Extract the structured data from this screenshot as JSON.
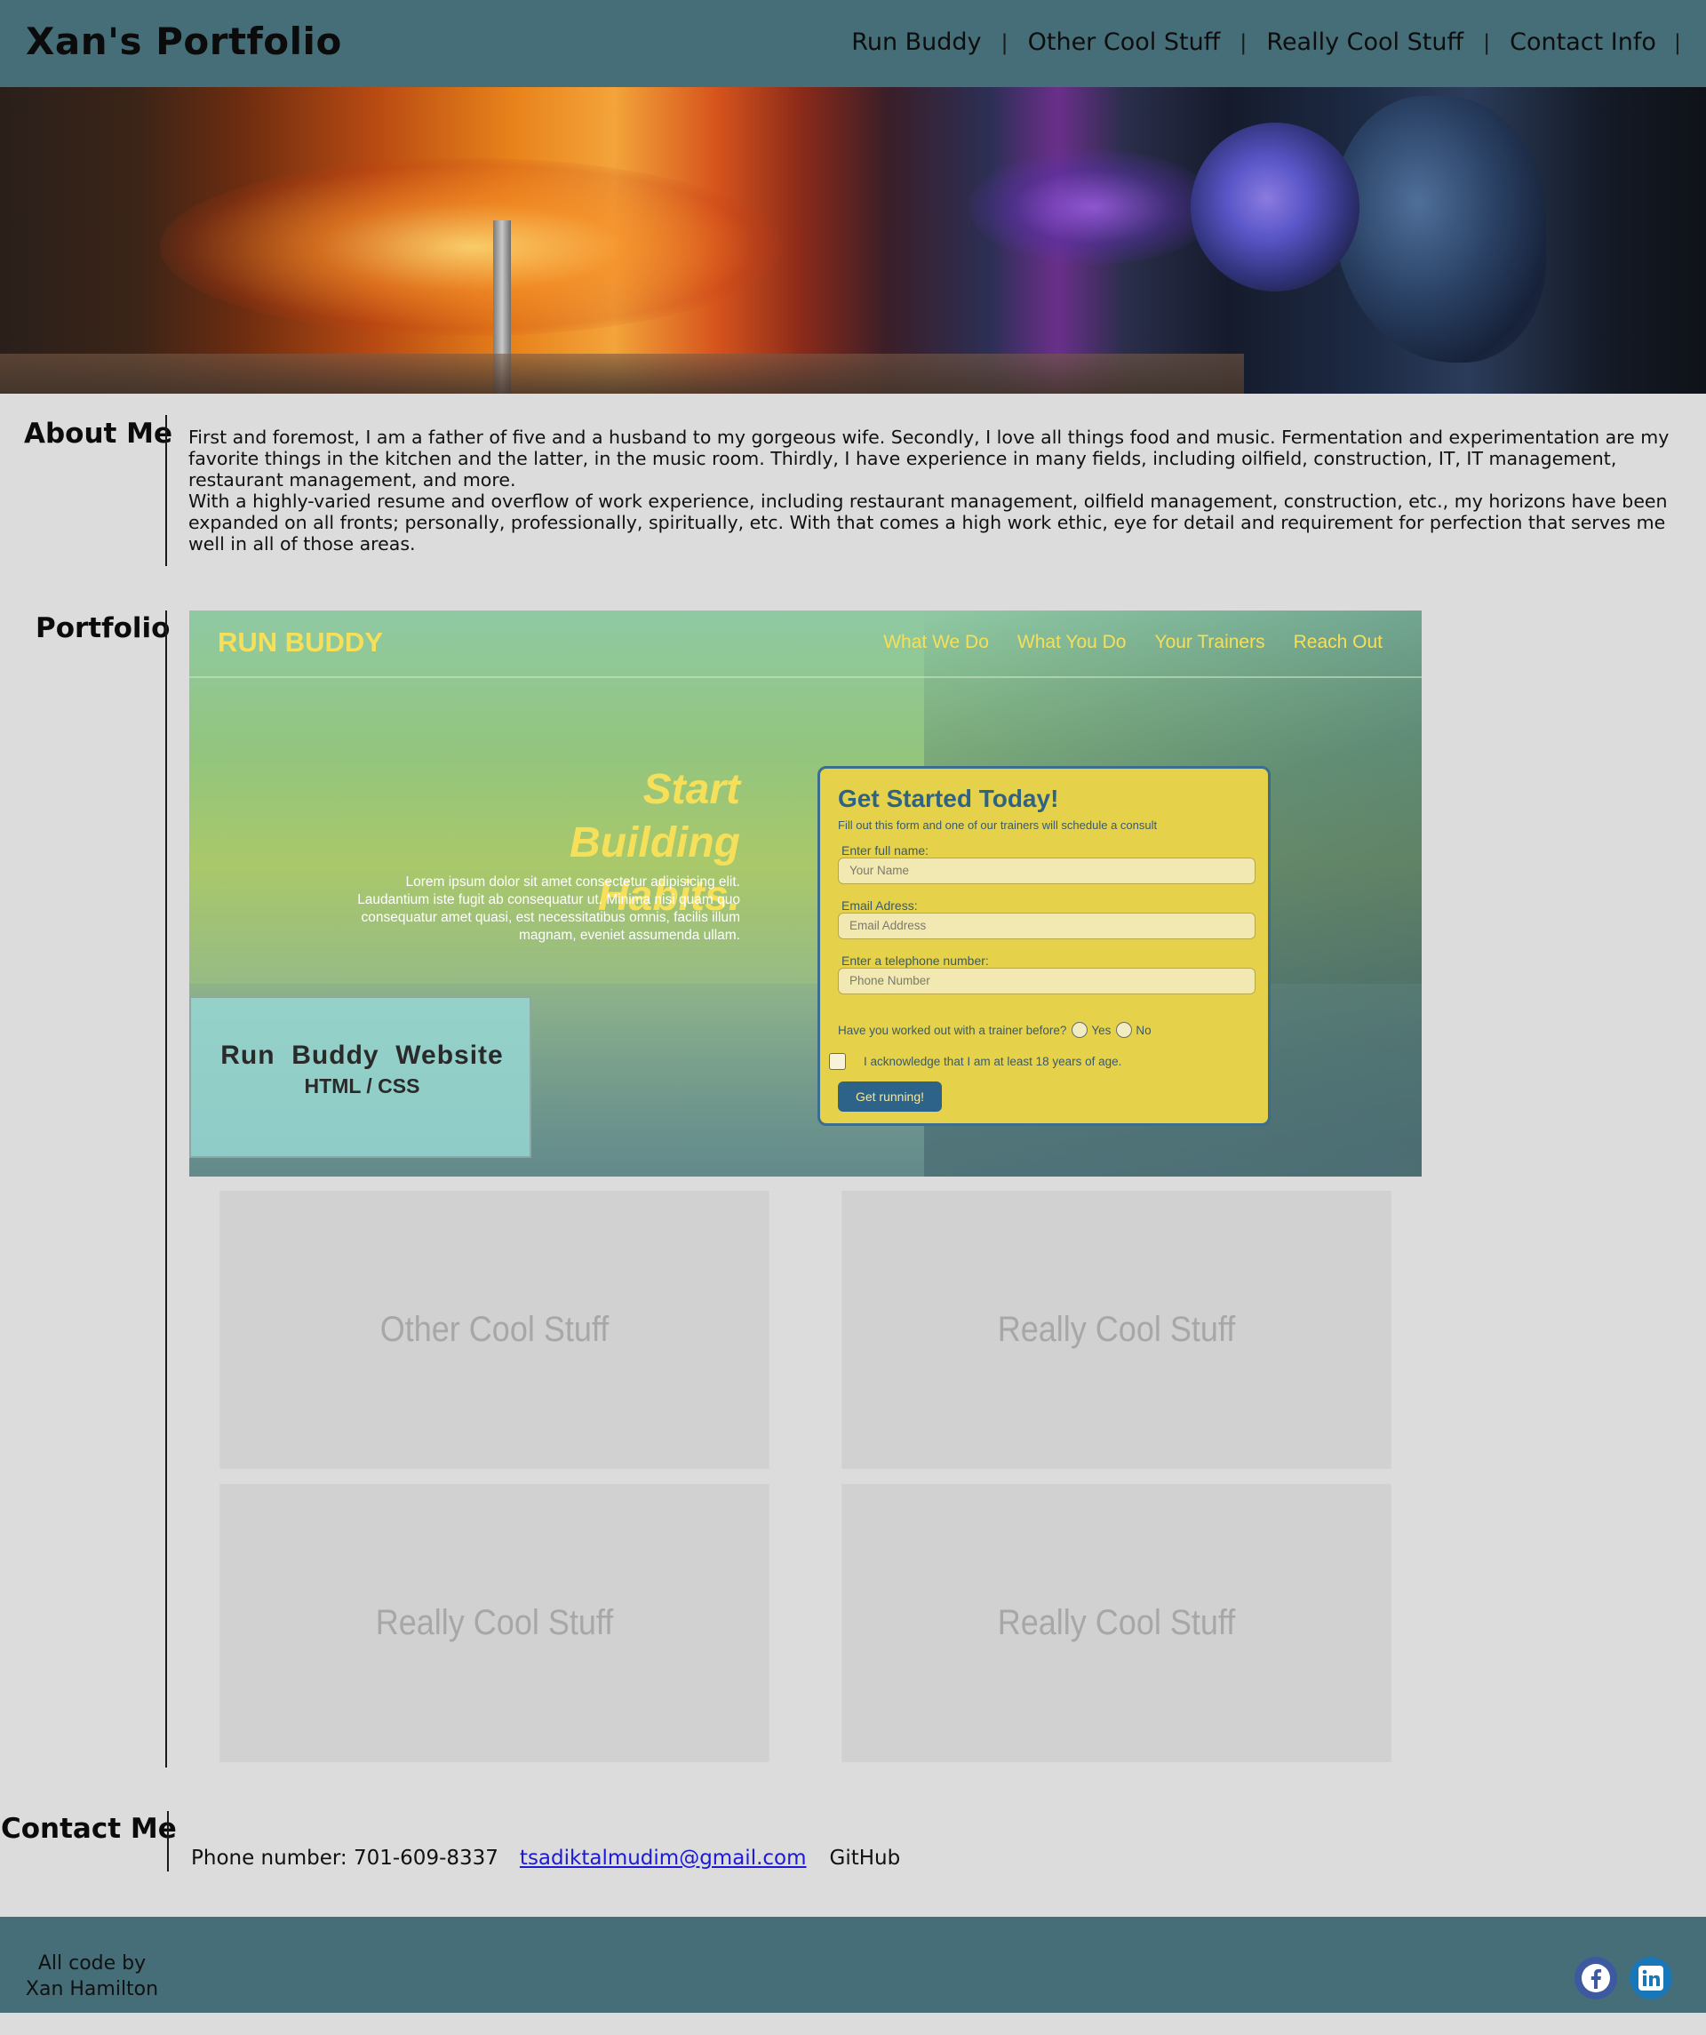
{
  "header": {
    "title": "Xan's Portfolio",
    "nav": [
      {
        "label": "Run Buddy"
      },
      {
        "label": "Other Cool Stuff"
      },
      {
        "label": "Really Cool Stuff"
      },
      {
        "label": "Contact Info"
      }
    ],
    "separator": "|"
  },
  "about": {
    "heading": "About Me",
    "paragraphs": [
      "First and foremost, I am a father of five and a husband to my gorgeous wife. Secondly, I love all things food and music. Fermentation and experimentation are my favorite things in the kitchen and the latter, in the music room. Thirdly, I have experience in many fields, including oilfield, construction, IT, IT management, restaurant management, and more.",
      "With a highly-varied resume and overflow of work experience, including restaurant management, oilfield management, construction, etc., my horizons have been expanded on all fronts; personally, professionally, spiritually, etc. With that comes a high work ethic, eye for detail and requirement for perfection that serves me well in all of those areas."
    ]
  },
  "portfolio": {
    "heading": "Portfolio",
    "featured": {
      "logo": "RUN BUDDY",
      "nav": [
        "What We Do",
        "What You Do",
        "Your Trainers",
        "Reach Out"
      ],
      "headline_line1": "Start Building",
      "headline_line2": "Habits.",
      "lorem": "Lorem ipsum dolor sit amet consectetur adipisicing elit. Laudantium iste fugit ab consequatur ut. Minima nisi quam quo consequatur amet quasi, est necessitatibus omnis, facilis illum magnam, eveniet assumenda ullam.",
      "card_title": "Run  Buddy  Website",
      "card_subtitle": "HTML / CSS",
      "form": {
        "title": "Get Started Today!",
        "subtitle": "Fill out this form and one of our trainers will schedule a consult",
        "name_label": "Enter full name:",
        "name_placeholder": "Your Name",
        "email_label": "Email Adress:",
        "email_placeholder": "Email Address",
        "phone_label": "Enter a telephone number:",
        "phone_placeholder": "Phone Number",
        "question": "Have you worked out with a trainer before?",
        "yes": "Yes",
        "no": "No",
        "acknowledge": "I acknowledge that I am at least 18 years of age.",
        "button": "Get running!"
      }
    },
    "tiles": [
      {
        "label": "Other Cool Stuff"
      },
      {
        "label": "Really Cool Stuff"
      },
      {
        "label": "Really Cool Stuff"
      },
      {
        "label": "Really Cool Stuff"
      }
    ]
  },
  "contact": {
    "heading": "Contact Me",
    "phone": "Phone number: 701-609-8337",
    "email": "tsadiktalmudim@gmail.com",
    "github": "GitHub"
  },
  "footer": {
    "credit_line1": "All code by",
    "credit_line2": "Xan Hamilton",
    "social": [
      {
        "icon": "facebook-icon",
        "color": "#3d5aa0"
      },
      {
        "icon": "linkedin-icon",
        "color": "#1a77b7"
      }
    ]
  }
}
